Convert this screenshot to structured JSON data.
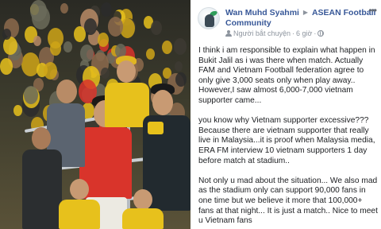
{
  "post": {
    "author": "Wan Muhd Syahmi",
    "group": "ASEAN Football Community",
    "role_label": "Người bắt chuyện",
    "time": "6 giờ",
    "more_label": "•••",
    "body_paragraphs": [
      "I think i am responsible to explain what happen in Bukit Jalil as i was there when match. Actually FAM and Vietnam Football federation agree to only give 3,000 seats only when play away.. However,I saw almost 6,000-7,000 vietnam supporter came...",
      "you know why Vietnam supporter excessive??? Because there are vietnam supporter that really live in Malaysia...it is proof when Malaysia media, ERA FM interview 10 vietnam supporters 1 day before match at stadium..",
      "Not only u mad about the situation... We also mad as the stadium only can support 90,000 fans in one time but we believe it more that 100,000+ fans at that night... It is just a match.. Nice to meet u Vietnam fans"
    ]
  },
  "colors": {
    "link": "#385898",
    "text": "#1c1e21",
    "muted": "#8d949e",
    "jersey_red": "#d9342b",
    "jersey_yellow": "#e7c11c"
  }
}
